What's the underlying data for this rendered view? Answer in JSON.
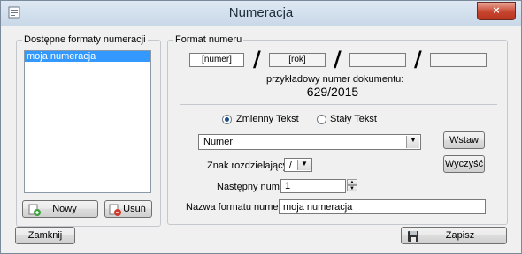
{
  "window": {
    "title": "Numeracja",
    "close_glyph": "×"
  },
  "formats_panel": {
    "title": "Dostępne formaty numeracji",
    "items": [
      "moja numeracja"
    ],
    "new_button": "Nowy",
    "delete_button": "Usuń"
  },
  "format_panel": {
    "title": "Format numeru",
    "segments": [
      "[numer]",
      "[rok]",
      "",
      ""
    ],
    "separator": "/",
    "example_label": "przykładowy numer dokumentu:",
    "example_value": "629/2015",
    "radio_variable": "Zmienny Tekst",
    "radio_fixed": "Stały Tekst",
    "variable_select": "Numer",
    "insert_button": "Wstaw",
    "clear_button": "Wyczyść",
    "separator_label": "Znak rozdzielający",
    "separator_value": "/",
    "next_number_label": "Następny numer:",
    "next_number_value": "1",
    "format_name_label": "Nazwa formatu numeracji",
    "format_name_value": "moja numeracja"
  },
  "footer": {
    "close_button": "Zamknij",
    "save_button": "Zapisz"
  },
  "colors": {
    "selection": "#3399ff",
    "close_button": "#c7452f"
  }
}
